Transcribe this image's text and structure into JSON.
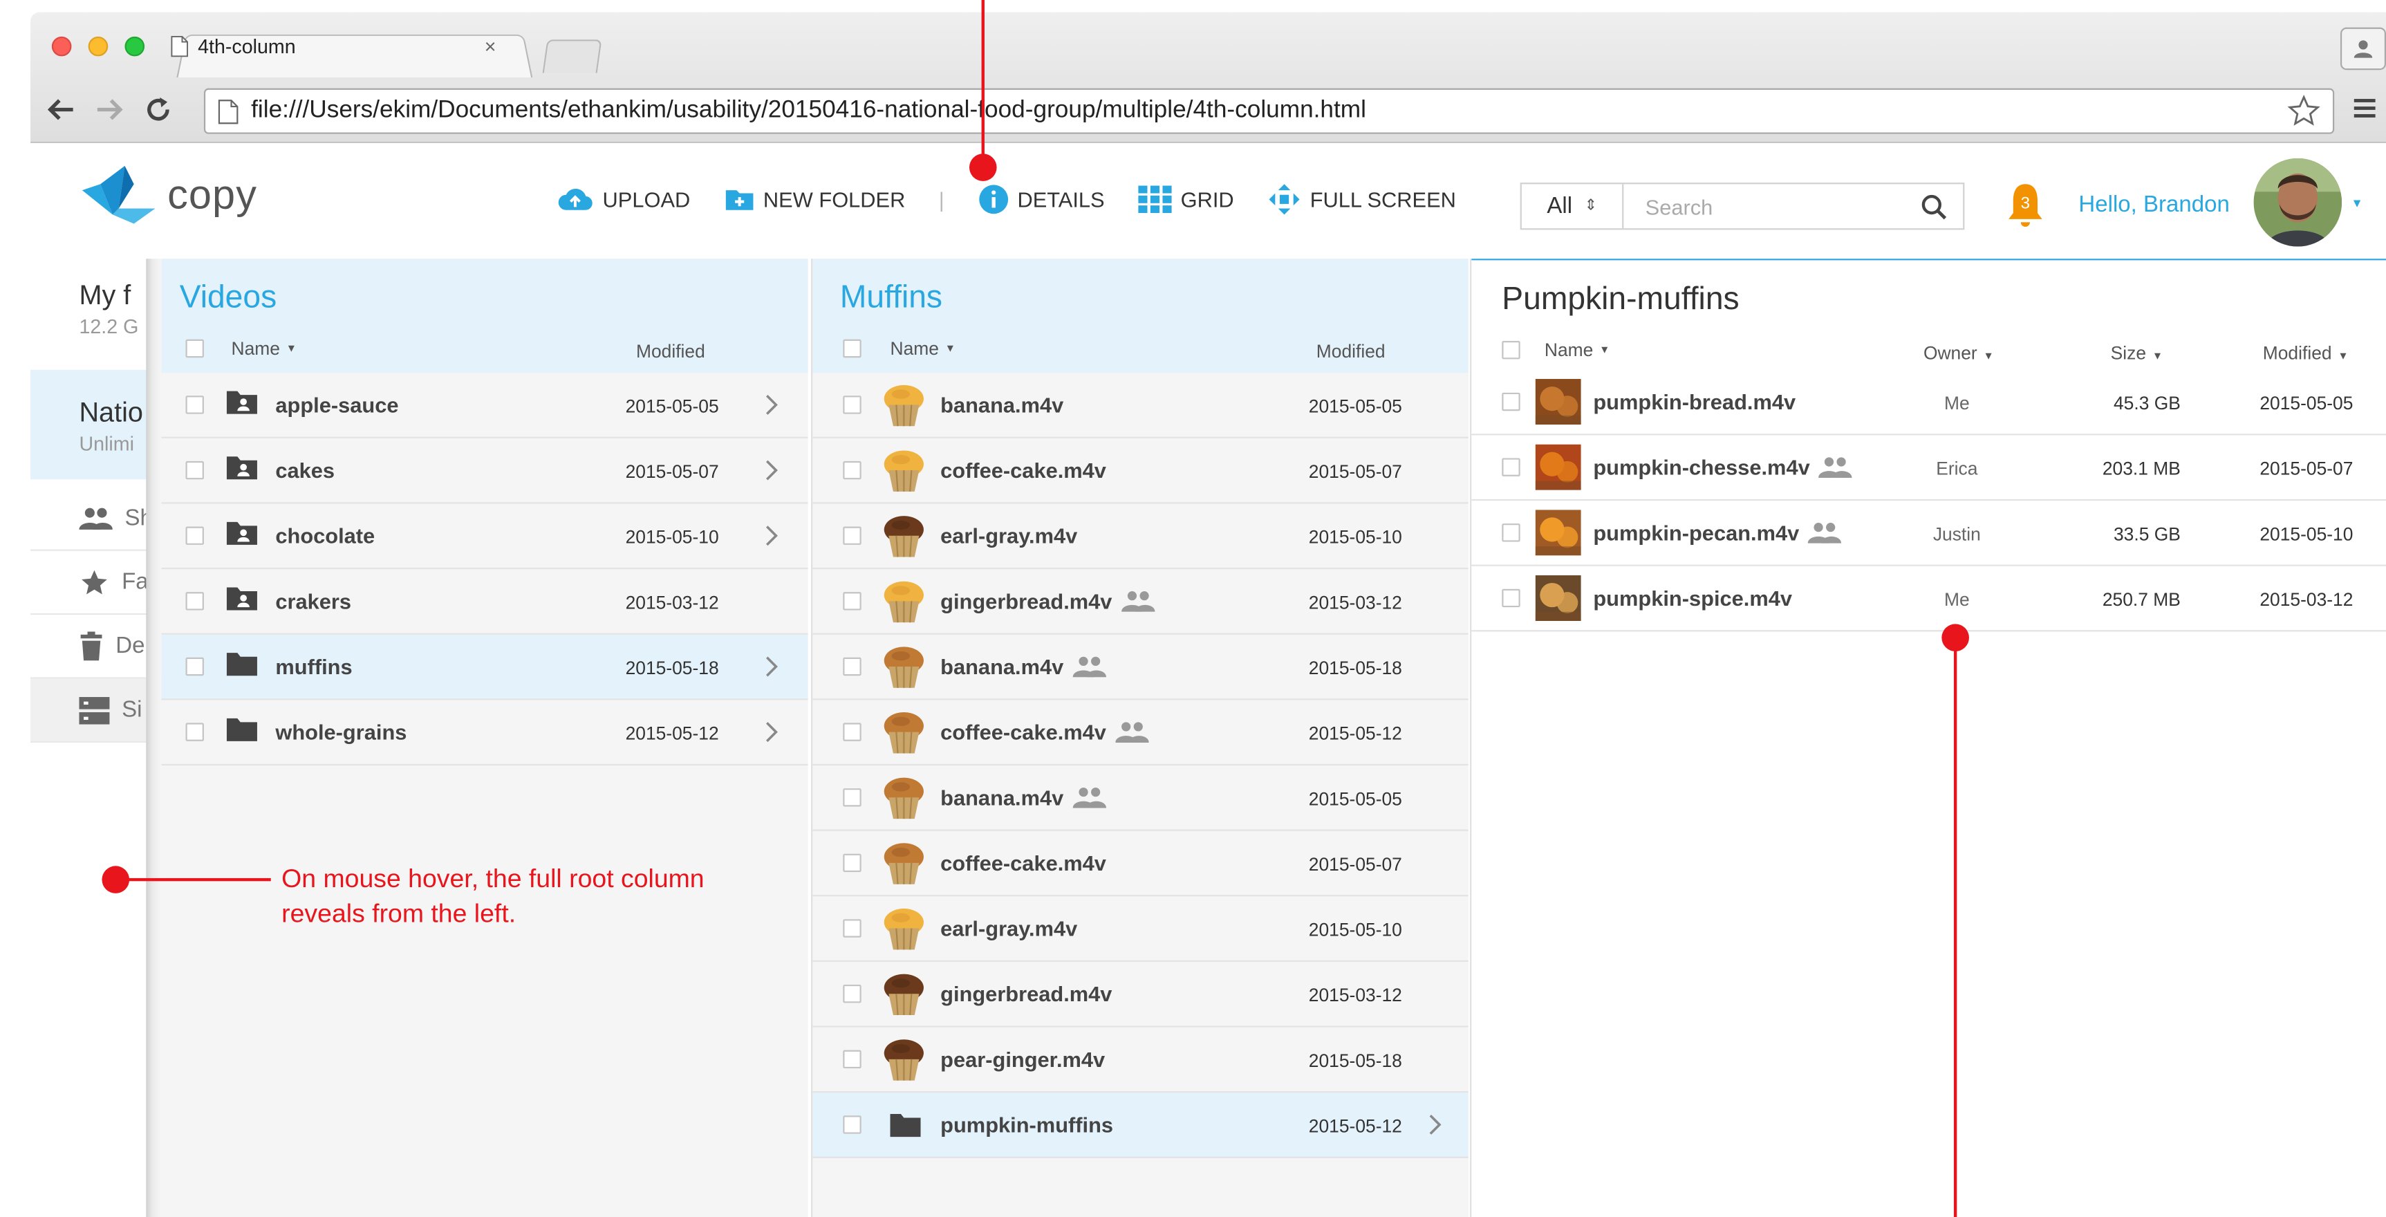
{
  "browser": {
    "tab_title": "4th-column",
    "tab_close": "×",
    "url": "file:///Users/ekim/Documents/ethankim/usability/20150416-national-food-group/multiple/4th-column.html"
  },
  "app": {
    "logo_text": "copy",
    "toolbar": {
      "upload": "UPLOAD",
      "new_folder": "NEW FOLDER",
      "separator": "|",
      "details": "DETAILS",
      "grid": "GRID",
      "full_screen": "FULL SCREEN"
    },
    "search": {
      "scope": "All",
      "placeholder": "Search"
    },
    "notifications": {
      "count": "3"
    },
    "greeting": "Hello, Brandon",
    "accent_color": "#29a7e0",
    "annotation_color": "#e8151c"
  },
  "root": {
    "my_files": {
      "title": "My f",
      "subtitle": "12.2 G"
    },
    "national": {
      "title": "Natio",
      "subtitle": "Unlimi"
    },
    "items": [
      {
        "label": "Sh",
        "icon": "people-icon"
      },
      {
        "label": "Fa",
        "icon": "star-icon"
      },
      {
        "label": "De",
        "icon": "trash-icon"
      },
      {
        "label": "Si",
        "icon": "server-icon"
      }
    ]
  },
  "videos": {
    "title": "Videos",
    "col_name": "Name",
    "col_modified": "Modified",
    "rows": [
      {
        "name": "apple-sauce",
        "modified": "2015-05-05"
      },
      {
        "name": "cakes",
        "modified": "2015-05-07"
      },
      {
        "name": "chocolate",
        "modified": "2015-05-10"
      },
      {
        "name": "crakers",
        "modified": "2015-03-12"
      },
      {
        "name": "muffins",
        "modified": "2015-05-18"
      },
      {
        "name": "whole-grains",
        "modified": "2015-05-12"
      }
    ]
  },
  "muffins": {
    "title": "Muffins",
    "col_name": "Name",
    "col_modified": "Modified",
    "rows": [
      {
        "name": "banana.m4v",
        "modified": "2015-05-05"
      },
      {
        "name": "coffee-cake.m4v",
        "modified": "2015-05-07"
      },
      {
        "name": "earl-gray.m4v",
        "modified": "2015-05-10"
      },
      {
        "name": "gingerbread.m4v",
        "modified": "2015-03-12"
      },
      {
        "name": "banana.m4v",
        "modified": "2015-05-18"
      },
      {
        "name": "coffee-cake.m4v",
        "modified": "2015-05-12"
      },
      {
        "name": "banana.m4v",
        "modified": "2015-05-05"
      },
      {
        "name": "coffee-cake.m4v",
        "modified": "2015-05-07"
      },
      {
        "name": "earl-gray.m4v",
        "modified": "2015-05-10"
      },
      {
        "name": "gingerbread.m4v",
        "modified": "2015-03-12"
      },
      {
        "name": "pear-ginger.m4v",
        "modified": "2015-05-18"
      },
      {
        "name": "pumpkin-muffins",
        "modified": "2015-05-12"
      }
    ]
  },
  "pumpkin": {
    "title": "Pumpkin-muffins",
    "col_name": "Name",
    "col_owner": "Owner",
    "col_size": "Size",
    "col_modified": "Modified",
    "rows": [
      {
        "name": "pumpkin-bread.m4v",
        "owner": "Me",
        "size": "45.3 GB",
        "modified": "2015-05-05"
      },
      {
        "name": "pumpkin-chesse.m4v",
        "owner": "Erica",
        "size": "203.1 MB",
        "modified": "2015-05-07"
      },
      {
        "name": "pumpkin-pecan.m4v",
        "owner": "Justin",
        "size": "33.5 GB",
        "modified": "2015-05-10"
      },
      {
        "name": "pumpkin-spice.m4v",
        "owner": "Me",
        "size": "250.7 MB",
        "modified": "2015-03-12"
      }
    ]
  },
  "annotation": {
    "text": "On mouse hover, the full root column reveals from the left."
  }
}
